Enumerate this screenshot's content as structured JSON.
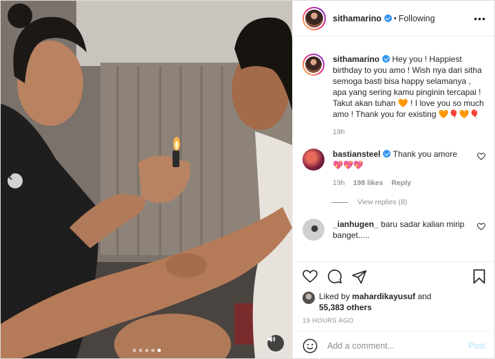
{
  "header": {
    "username": "sithamarino",
    "separator": "•",
    "follow_status": "Following",
    "more_icon": "more-dots-icon"
  },
  "caption": {
    "username": "sithamarino",
    "text_part1": "Hey you ! Happiest birthday to you amo ! Wish nya dari sitha semoga basti bisa happy selamanya , apa yang sering kamu pinginin tercapai ! Takut akan tuhan",
    "emoji1": "🧡",
    "text_part2": "! I love you so much amo ! Thank you for existing",
    "emoji2": "🧡🎈🧡🎈",
    "time": "19h"
  },
  "comments": [
    {
      "username": "bastiansteel",
      "verified": true,
      "text": "Thank you amore",
      "emojis": "💖💖💖",
      "time": "19h",
      "likes": "198 likes",
      "reply_label": "Reply",
      "view_replies": "View replies (8)"
    },
    {
      "username": "_ianhugen_",
      "verified": false,
      "text": "baru sadar kalian mirip banget....."
    }
  ],
  "likes": {
    "prefix": "Liked by",
    "user": "mahardikayusuf",
    "middle": "and",
    "count": "55,383 others"
  },
  "time_ago": "19 HOURS AGO",
  "add_comment": {
    "placeholder": "Add a comment...",
    "post_label": "Post"
  },
  "carousel": {
    "total_slides": 5,
    "active_slide": 5
  },
  "colors": {
    "verified": "#3897f0",
    "post_disabled": "#b2dffc",
    "secondary_text": "#8e8e8e"
  }
}
